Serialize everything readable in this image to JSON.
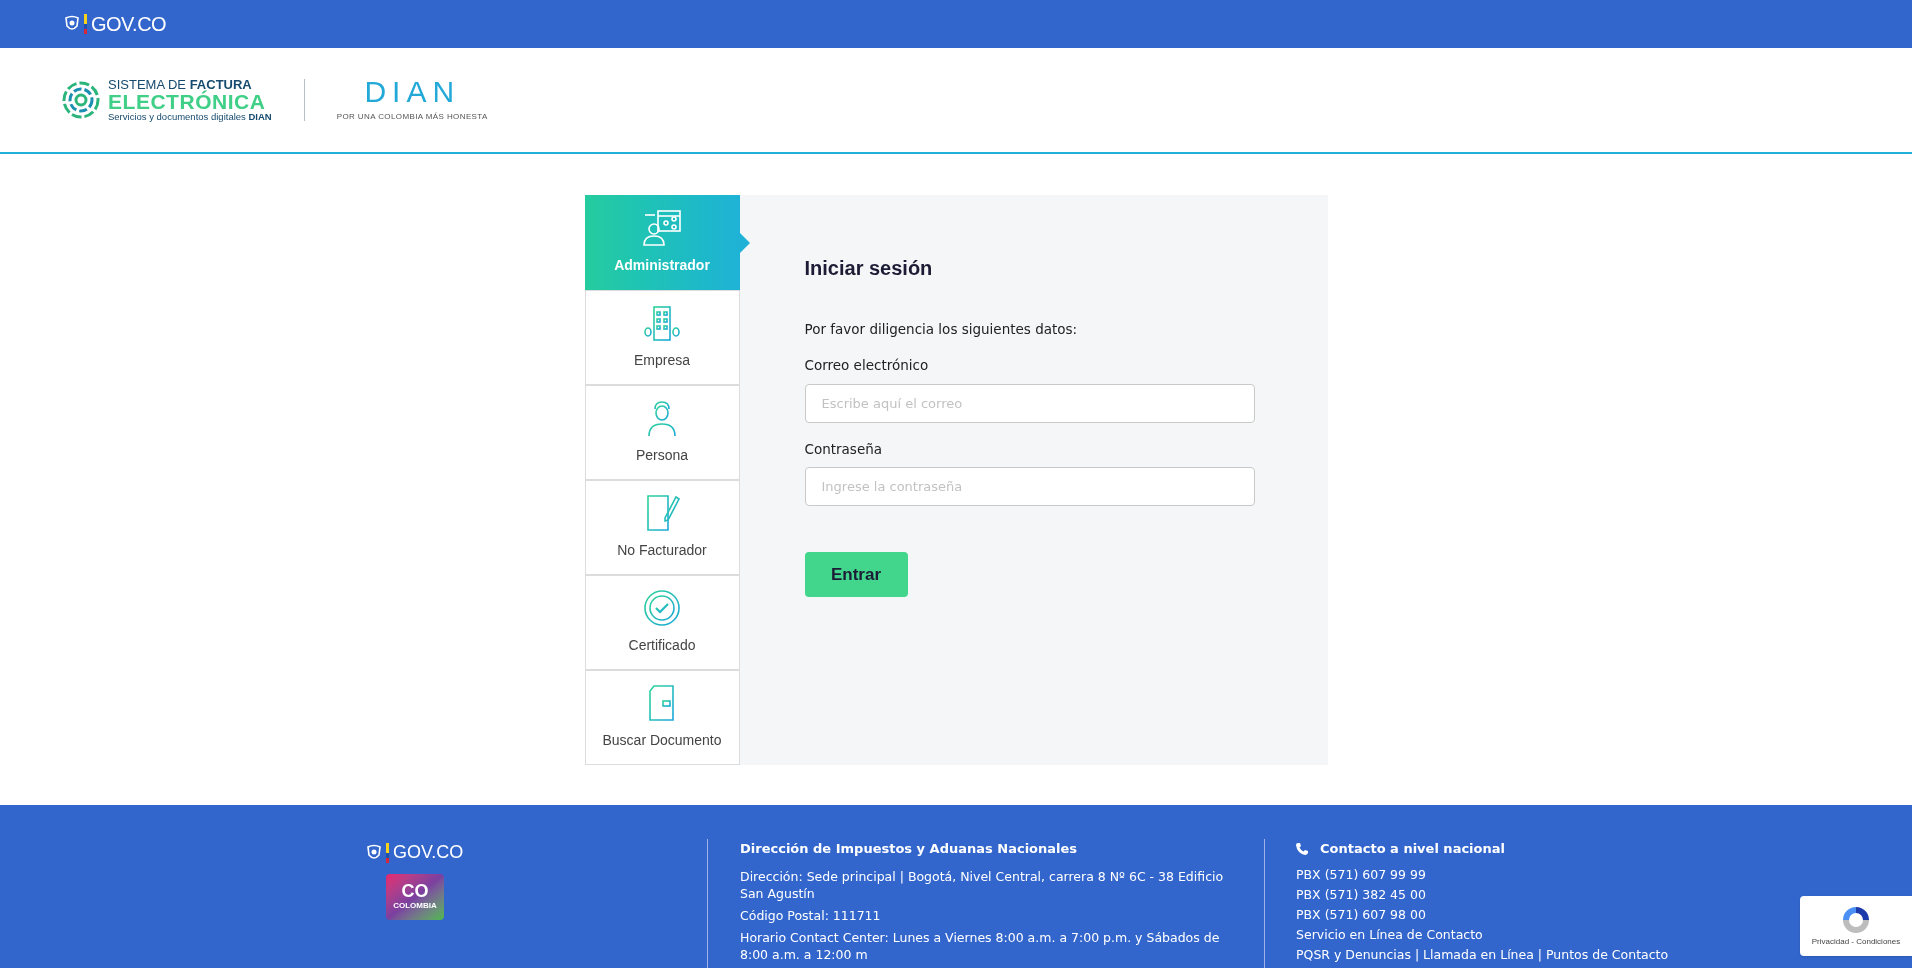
{
  "top_bar": {
    "brand": "GOV.CO"
  },
  "header": {
    "logo": {
      "line1_plain": "SISTEMA DE ",
      "line1_bold": "FACTURA",
      "line2": "ELECTRÓNICA",
      "line3": "Servicios y documentos digitales **DIAN**"
    },
    "partner_logo": {
      "name": "DIAN",
      "tagline": "POR UNA COLOMBIA MÁS HONESTA"
    }
  },
  "profile_tabs": [
    {
      "label": "Administrador",
      "kind": "admin",
      "selected": true
    },
    {
      "label": "Empresa",
      "kind": "building",
      "selected": false
    },
    {
      "label": "Persona",
      "kind": "person",
      "selected": false
    },
    {
      "label": "No Facturador",
      "kind": "document-pen",
      "selected": false
    },
    {
      "label": "Certificado",
      "kind": "seal",
      "selected": false
    },
    {
      "label": "Buscar Documento",
      "kind": "document",
      "selected": false
    }
  ],
  "login_form": {
    "title": "Iniciar sesión",
    "instructions": "Por favor diligencia los siguientes datos:",
    "fields": [
      {
        "label": "Correo electrónico",
        "placeholder": "Escribe aquí el correo"
      },
      {
        "label": "Contraseña",
        "placeholder": "Ingrese la contraseña"
      }
    ],
    "submit": "Entrar"
  },
  "footer": {
    "brand": "GOV.CO",
    "country_logo": {
      "mark": "CO",
      "name": "COLOMBIA"
    },
    "entity": {
      "title": "Dirección de Impuestos y Aduanas Nacionales",
      "lines": [
        "Dirección: Sede principal | Bogotá, Nivel Central, carrera 8 Nº 6C - 38 Edificio San Agustín",
        "Código Postal: 111711",
        "Horario Contact Center: Lunes a Viernes 8:00 a.m. a 7:00 p.m. y Sábados de 8:00 a.m. a 12:00 m"
      ]
    },
    "contact": {
      "title": "Contacto a nivel nacional",
      "lines": [
        "PBX (571) 607 99 99",
        "PBX (571) 382 45 00",
        "PBX (571) 607 98 00",
        "Servicio en Línea de Contacto",
        "PQSR y Denuncias | Llamada en Línea | Puntos de Contacto"
      ]
    }
  },
  "recaptcha": {
    "links": "Privacidad - Condiciones"
  }
}
